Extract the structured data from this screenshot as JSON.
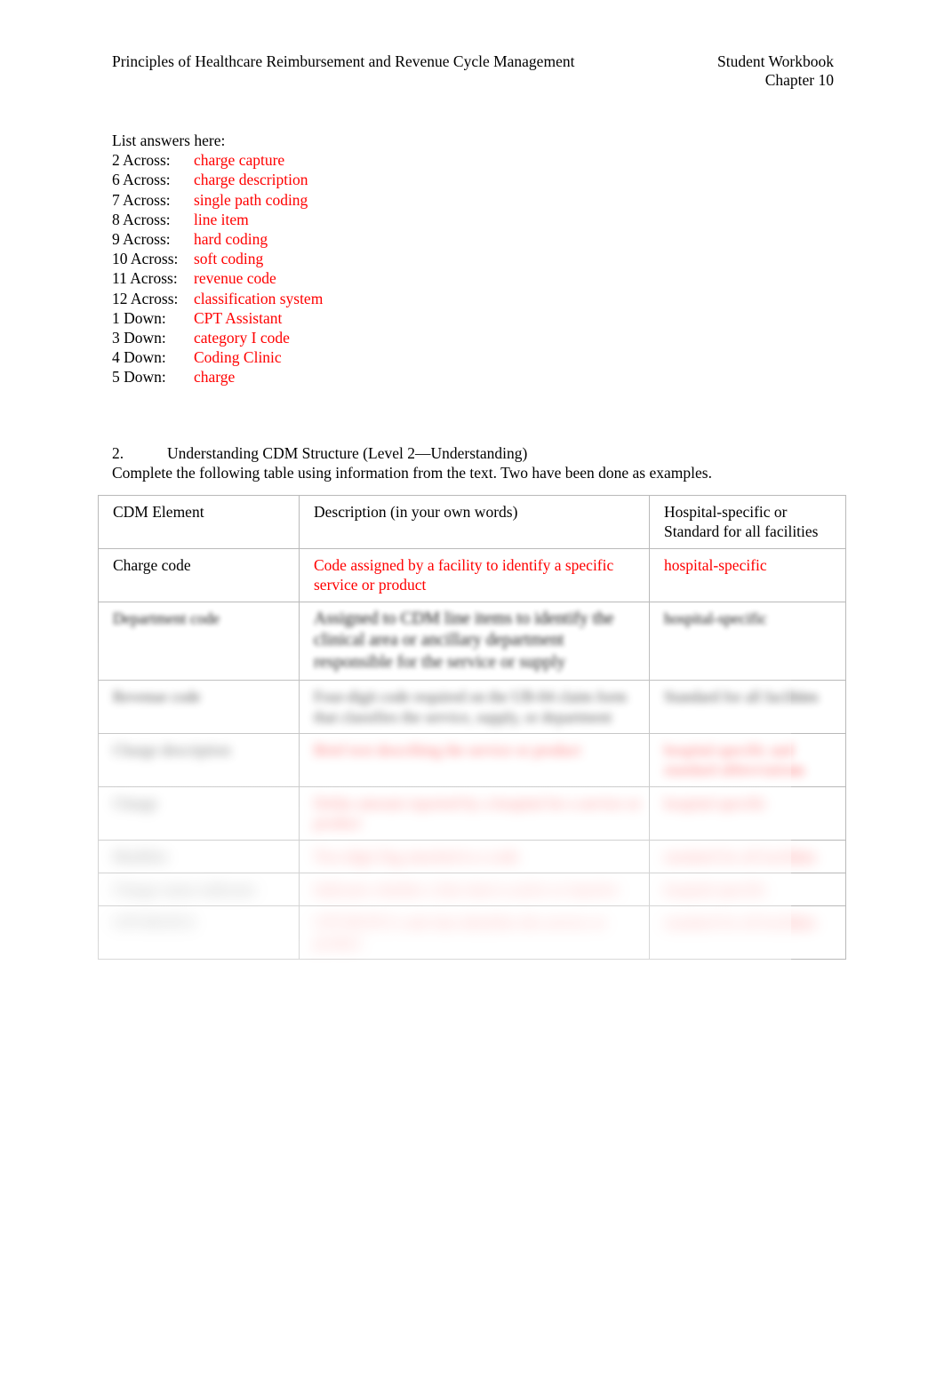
{
  "header": {
    "left": "Principles of Healthcare Reimbursement and Revenue Cycle Management",
    "right_line1": "Student Workbook",
    "right_line2": "Chapter 10"
  },
  "answers": {
    "title": "List answers here:",
    "rows": [
      {
        "label": "2 Across:",
        "value": "charge capture"
      },
      {
        "label": "6 Across:",
        "value": "charge description"
      },
      {
        "label": "7 Across:",
        "value": "single path coding"
      },
      {
        "label": "8 Across:",
        "value": "line item"
      },
      {
        "label": "9 Across:",
        "value": "hard coding"
      },
      {
        "label": "10 Across:",
        "value": "soft coding"
      },
      {
        "label": "11 Across:",
        "value": "revenue code"
      },
      {
        "label": "12 Across:",
        "value": "classification system"
      },
      {
        "label": "1 Down:",
        "value": "CPT Assistant"
      },
      {
        "label": "3 Down:",
        "value": "category I code"
      },
      {
        "label": "4 Down:",
        "value": "Coding Clinic"
      },
      {
        "label": "5 Down:",
        "value": "charge"
      }
    ]
  },
  "question2": {
    "number": "2.",
    "heading": "Understanding CDM Structure (Level 2—Understanding)",
    "instructions": "Complete the following table using information from the text. Two have been done as examples."
  },
  "table": {
    "headers": {
      "col1": "CDM Element",
      "col2": "Description (in your own words)",
      "col3": "Hospital-specific or Standard for all facilities"
    },
    "rows": [
      {
        "element": "Charge code",
        "element_color": "#000000",
        "description": "Code assigned by a facility to identify a specific service or product",
        "description_color": "#ff0000",
        "scope": "hospital-specific",
        "scope_color": "#ff0000",
        "blur": 1
      },
      {
        "element": "Department code",
        "element_color": "#000000",
        "description": "Assigned to CDM line items to identify the clinical area or ancillary department responsible for the service or supply",
        "description_color": "#000000",
        "scope": "hospital-specific",
        "scope_color": "#000000",
        "blur": 2
      },
      {
        "element": "Revenue code",
        "element_color": "#000000",
        "description": "Four-digit code required on the UB-04 claim form that classifies the service, supply, or department",
        "description_color": "#000000",
        "scope": "Standard for all facilities",
        "scope_color": "#000000",
        "blur": 3
      },
      {
        "element": "Charge description",
        "element_color": "#000000",
        "description": "Brief text describing the service or product",
        "description_color": "#ff0000",
        "scope": "hospital-specific and standard abbreviations",
        "scope_color": "#ff0000",
        "blur": 4
      },
      {
        "element": "Charge",
        "element_color": "#000000",
        "description": "Dollar amount reported by a hospital for a service or product",
        "description_color": "#ff0000",
        "scope": "hospital-specific",
        "scope_color": "#ff0000",
        "blur": 5
      },
      {
        "element": "Modifier",
        "element_color": "#000000",
        "description": "Two-digit flag attached to a code",
        "description_color": "#ff0000",
        "scope": "standard for all facilities",
        "scope_color": "#ff0000",
        "blur": 6
      },
      {
        "element": "Charge status indicator",
        "element_color": "#000000",
        "description": "Indicates whether a line item is active or inactive",
        "description_color": "#ff0000",
        "scope": "hospital-specific",
        "scope_color": "#ff0000",
        "blur": 7
      },
      {
        "element": "CPT/HCPCS",
        "element_color": "#000000",
        "description": "CPT/HCPCS code that identifies the service or product",
        "description_color": "#ff0000",
        "scope": "standard for all facilities",
        "scope_color": "#ff0000",
        "blur": 7
      }
    ]
  },
  "colors": {
    "answer_red": "#ff0000",
    "text_black": "#000000",
    "table_border": "#b9b9b9"
  }
}
